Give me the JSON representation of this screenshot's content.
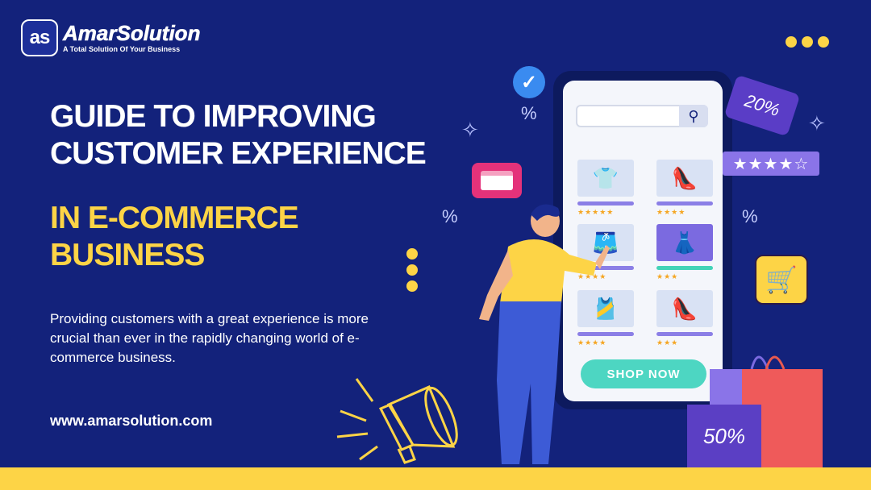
{
  "brand": {
    "logo_mark": "as",
    "name": "AmarSolution",
    "tagline": "A Total Solution Of Your Business"
  },
  "headline": {
    "line1": "GUIDE TO IMPROVING",
    "line2": "CUSTOMER EXPERIENCE"
  },
  "subheadline": {
    "line1": "IN E-COMMERCE",
    "line2": "BUSINESS"
  },
  "description": "Providing customers with a great experience is more crucial than ever in the rapidly changing world of e-commerce business.",
  "website": "www.amarsolution.com",
  "phone": {
    "shop_button": "SHOP NOW",
    "products": [
      {
        "icon": "shirt-icon",
        "stars": "★★★★★"
      },
      {
        "icon": "heel-icon",
        "stars": "★★★★"
      },
      {
        "icon": "shorts-icon",
        "stars": "★★★★"
      },
      {
        "icon": "dress-icon",
        "stars": "★★★"
      },
      {
        "icon": "tanktop-icon",
        "stars": "★★★★"
      },
      {
        "icon": "heel-icon",
        "stars": "★★★"
      }
    ]
  },
  "decor": {
    "discount_tag": "20%",
    "bag_label": "50%",
    "rating": "★★★★☆",
    "percent_symbol": "%"
  },
  "colors": {
    "background": "#13227b",
    "accent_yellow": "#fdd446",
    "teal": "#4dd6c2",
    "purple": "#5b3fc4",
    "pink": "#e4327a"
  }
}
